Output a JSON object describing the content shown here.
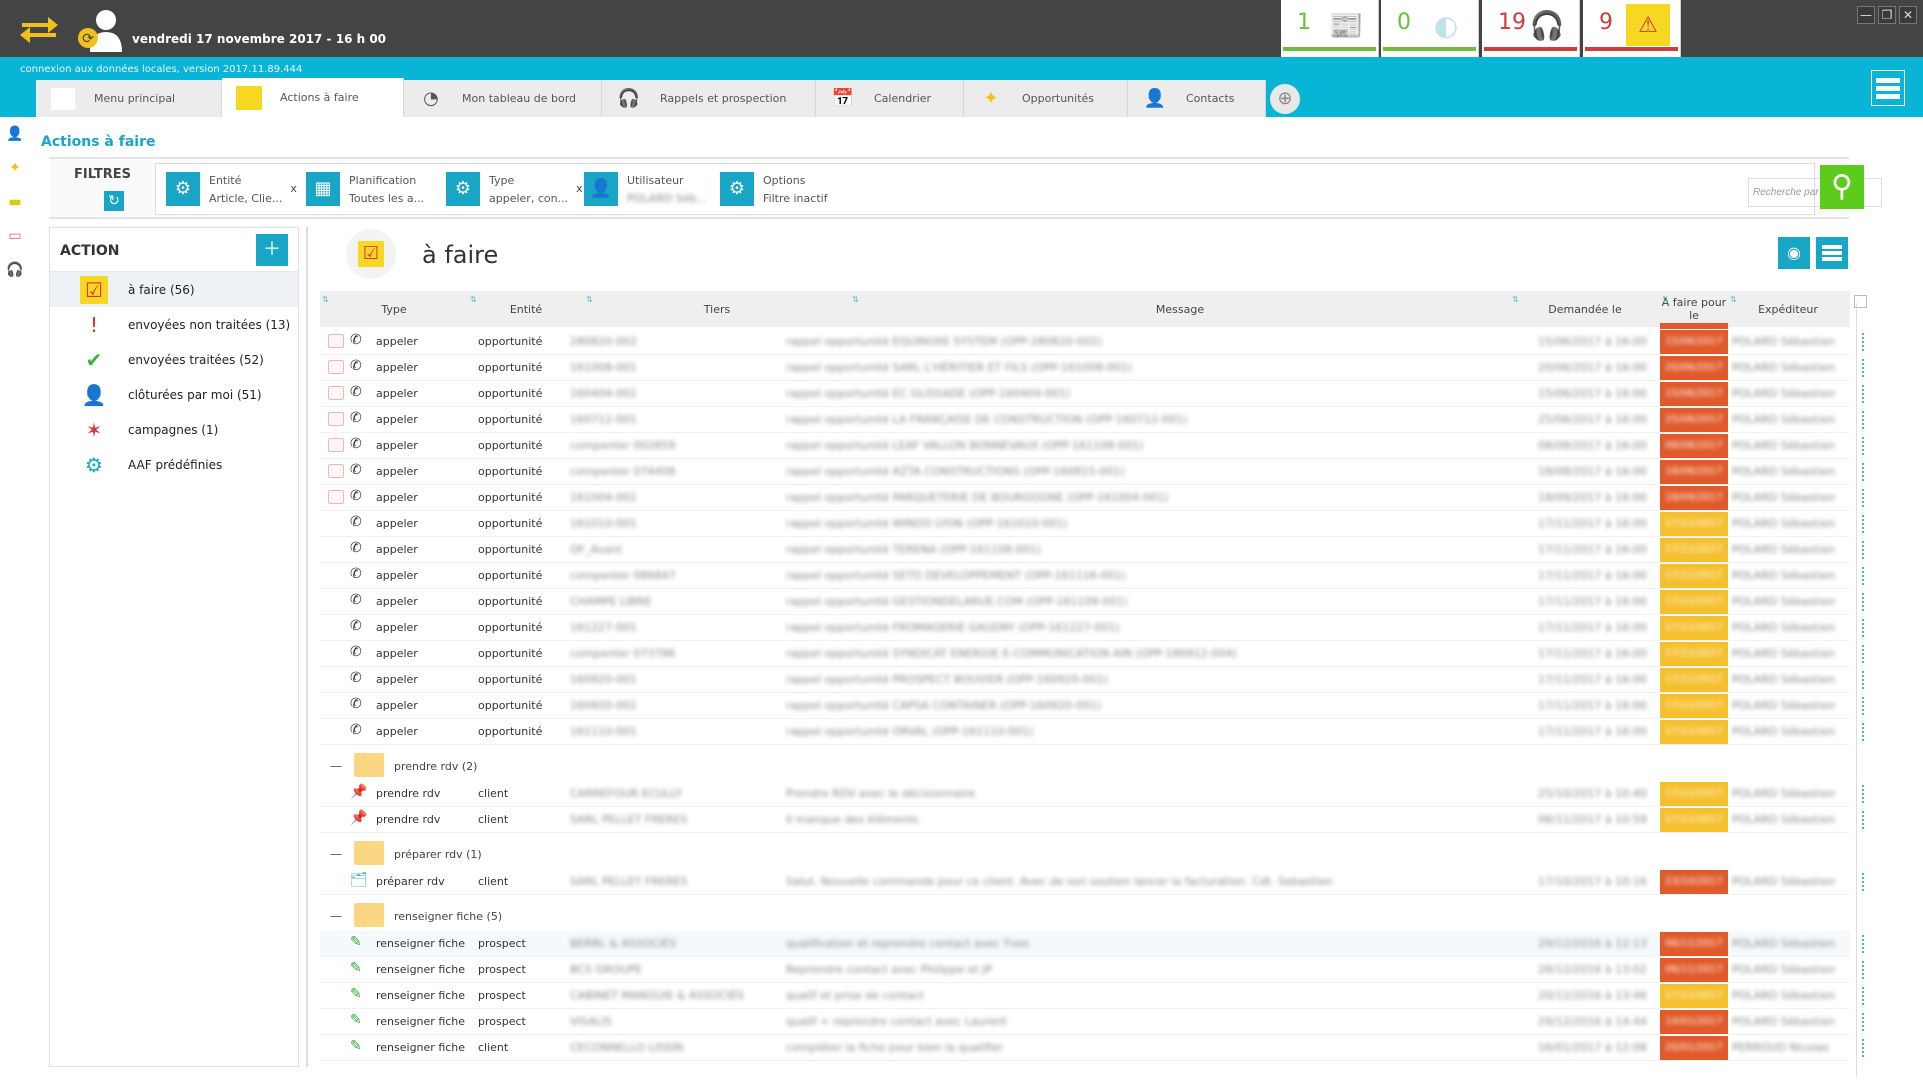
{
  "topbar": {
    "datetime": "vendredi 17 novembre 2017 - 16 h 00",
    "counters": [
      {
        "name": "news",
        "value": "1",
        "icon": "newspaper-icon",
        "color": "#6cbf3a"
      },
      {
        "name": "messages",
        "value": "0",
        "icon": "chat-bubble-icon",
        "color": "#6cbf3a"
      },
      {
        "name": "calls",
        "value": "19",
        "icon": "headset-icon",
        "color": "#c9403b"
      },
      {
        "name": "alerts",
        "value": "9",
        "icon": "warning-icon",
        "color": "#c9403b"
      }
    ],
    "window_buttons": [
      "—",
      "❐",
      "✕"
    ]
  },
  "connection_status": "connexion aux données locales, version 2017.11.89.444",
  "tabs": [
    {
      "label": "Menu principal",
      "icon": "home-icon"
    },
    {
      "label": "Actions à faire",
      "icon": "sticky-note-icon",
      "active": true
    },
    {
      "label": "Mon tableau de bord",
      "icon": "gauge-icon"
    },
    {
      "label": "Rappels et prospection",
      "icon": "headset-icon"
    },
    {
      "label": "Calendrier",
      "icon": "calendar-icon"
    },
    {
      "label": "Opportunités",
      "icon": "opportunity-icon"
    },
    {
      "label": "Contacts",
      "icon": "contacts-icon"
    }
  ],
  "breadcrumb": "Actions à faire",
  "filters": {
    "title": "FILTRES",
    "items": [
      {
        "label": "Entité",
        "value": "Article, Clie...",
        "removable": true
      },
      {
        "label": "Planification",
        "value": "Toutes les a...",
        "removable": false
      },
      {
        "label": "Type",
        "value": "appeler, con...",
        "removable": true
      },
      {
        "label": "Utilisateur",
        "value": "POLARD Séb...",
        "removable": false
      },
      {
        "label": "Options",
        "value": "Filtre inactif",
        "removable": false
      }
    ],
    "remove_label": "x",
    "search_placeholder": "Recherche par mot clé"
  },
  "action_panel": {
    "title": "ACTION",
    "items": [
      {
        "label": "à faire (56)",
        "icon": "todo-check-icon",
        "active": true
      },
      {
        "label": "envoyées non traitées (13)",
        "icon": "exclamation-icon"
      },
      {
        "label": "envoyées traitées (52)",
        "icon": "checkmark-icon"
      },
      {
        "label": "clôturées par moi (51)",
        "icon": "user-closed-icon"
      },
      {
        "label": "campagnes (1)",
        "icon": "campaign-icon"
      },
      {
        "label": "AAF prédéfinies",
        "icon": "gears-icon"
      }
    ]
  },
  "main": {
    "title": "à faire",
    "columns": [
      "Type",
      "Entité",
      "Tiers",
      "Message",
      "Demandée le",
      "A faire pour le",
      "Expéditeur"
    ],
    "due_colors": {
      "late": "#e05a2b",
      "today": "#f5c02e"
    },
    "call_rows": [
      {
        "type": "appeler",
        "entity": "opportunité",
        "tiers": "280820-002",
        "message": "rappel opportunité EQUINOXE SYSTEM (OPP-280820-002)",
        "requested": "15/06/2017 à 16:00",
        "due": "15/06/2017",
        "status": "late",
        "sender": "POLARD Sébastien",
        "flag": true
      },
      {
        "type": "appeler",
        "entity": "opportunité",
        "tiers": "161008-001",
        "message": "rappel opportunité SARL L'HÉRITIER ET FILS (OPP-161008-001)",
        "requested": "20/06/2017 à 16:00",
        "due": "20/06/2017",
        "status": "late",
        "sender": "POLARD Sébastien",
        "flag": true
      },
      {
        "type": "appeler",
        "entity": "opportunité",
        "tiers": "160404-001",
        "message": "rappel opportunité EC GLISSADE (OPP-160404-001)",
        "requested": "15/06/2017 à 16:00",
        "due": "15/06/2017",
        "status": "late",
        "sender": "POLARD Sébastien",
        "flag": true
      },
      {
        "type": "appeler",
        "entity": "opportunité",
        "tiers": "160712-001",
        "message": "rappel opportunité LA FRANÇAISE DE CONSTRUCTION (OPP-160712-001)",
        "requested": "25/06/2017 à 16:00",
        "due": "25/06/2017",
        "status": "late",
        "sender": "POLARD Sébastien",
        "flag": true
      },
      {
        "type": "appeler",
        "entity": "opportunité",
        "tiers": "compenter 002859",
        "message": "rappel opportunité LEAF VALLON BONNEVAUX (OPP-161108-001)",
        "requested": "08/08/2017 à 16:00",
        "due": "08/08/2017",
        "status": "late",
        "sender": "POLARD Sébastien",
        "flag": true
      },
      {
        "type": "appeler",
        "entity": "opportunité",
        "tiers": "compenter 074408",
        "message": "rappel opportunité AZTA CONSTRUCTIONS (OPP-160815-001)",
        "requested": "18/08/2017 à 16:00",
        "due": "18/08/2017",
        "status": "late",
        "sender": "POLARD Sébastien",
        "flag": true
      },
      {
        "type": "appeler",
        "entity": "opportunité",
        "tiers": "161004-001",
        "message": "rappel opportunité PARQUETERIE DE BOURGOGNE (OPP-161004-001)",
        "requested": "18/09/2017 à 16:00",
        "due": "18/09/2017",
        "status": "late",
        "sender": "POLARD Sébastien",
        "flag": true
      },
      {
        "type": "appeler",
        "entity": "opportunité",
        "tiers": "161010-001",
        "message": "rappel opportunité WINDO LYON (OPP-161010-001)",
        "requested": "17/11/2017 à 16:00",
        "due": "17/11/2017",
        "status": "today",
        "sender": "POLARD Sébastien",
        "flag": false
      },
      {
        "type": "appeler",
        "entity": "opportunité",
        "tiers": "OF_Avant",
        "message": "rappel opportunité TERENA (OPP-161108-001)",
        "requested": "17/11/2017 à 16:00",
        "due": "17/11/2017",
        "status": "today",
        "sender": "POLARD Sébastien",
        "flag": false
      },
      {
        "type": "appeler",
        "entity": "opportunité",
        "tiers": "compenter 086847",
        "message": "rappel opportunité SETO DEVELOPPEMENT (OPP-161116-001)",
        "requested": "17/11/2017 à 16:00",
        "due": "17/11/2017",
        "status": "today",
        "sender": "POLARD Sébastien",
        "flag": false
      },
      {
        "type": "appeler",
        "entity": "opportunité",
        "tiers": "CHAMPE LIBRE",
        "message": "rappel opportunité GESTIONDELARUE.COM (OPP-161109-001)",
        "requested": "17/11/2017 à 16:00",
        "due": "17/11/2017",
        "status": "today",
        "sender": "POLARD Sébastien",
        "flag": false
      },
      {
        "type": "appeler",
        "entity": "opportunité",
        "tiers": "161227-001",
        "message": "rappel opportunité FROMAGERIE GAUDRY (OPP-161227-001)",
        "requested": "17/11/2017 à 16:00",
        "due": "17/11/2017",
        "status": "today",
        "sender": "POLARD Sébastien",
        "flag": false
      },
      {
        "type": "appeler",
        "entity": "opportunité",
        "tiers": "compenter 073786",
        "message": "rappel opportunité SYNDICAT ENERGIE E-COMMUNICATION AIN (OPP-180912-004)",
        "requested": "17/11/2017 à 16:00",
        "due": "17/11/2017",
        "status": "today",
        "sender": "POLARD Sébastien",
        "flag": false
      },
      {
        "type": "appeler",
        "entity": "opportunité",
        "tiers": "160920-001",
        "message": "rappel opportunité PROSPECT BOUVIER (OPP-160920-001)",
        "requested": "17/11/2017 à 16:00",
        "due": "17/11/2017",
        "status": "today",
        "sender": "POLARD Sébastien",
        "flag": false
      },
      {
        "type": "appeler",
        "entity": "opportunité",
        "tiers": "160920-001",
        "message": "rappel opportunité CAPSA CONTAINER (OPP-160920-001)",
        "requested": "17/11/2017 à 16:00",
        "due": "17/11/2017",
        "status": "today",
        "sender": "POLARD Sébastien",
        "flag": false
      },
      {
        "type": "appeler",
        "entity": "opportunité",
        "tiers": "161110-001",
        "message": "rappel opportunité ORVAL (OPP-161110-001)",
        "requested": "17/11/2017 à 16:00",
        "due": "17/11/2017",
        "status": "today",
        "sender": "POLARD Sébastien",
        "flag": false
      }
    ],
    "groups": [
      {
        "label": "prendre rdv (2)",
        "rows": [
          {
            "type": "prendre rdv",
            "entity": "client",
            "tiers": "CARREFOUR ECULLY",
            "message": "Prendre RDV avec le décisionnaire",
            "requested": "25/10/2017 à 10:40",
            "due": "17/11/2017",
            "status": "today",
            "sender": "POLARD Sébastien"
          },
          {
            "type": "prendre rdv",
            "entity": "client",
            "tiers": "SARL PELLET FRERES",
            "message": "Il manque des éléments",
            "requested": "06/11/2017 à 10:59",
            "due": "17/11/2017",
            "status": "today",
            "sender": "POLARD Sébastien"
          }
        ]
      },
      {
        "label": "préparer rdv (1)",
        "rows": [
          {
            "type": "préparer rdv",
            "entity": "client",
            "tiers": "SARL PELLET FRERES",
            "message": "Salut. Nouvelle commande pour ce client. Avec de son soutien lancer la facturation. Cdt. Sebastien",
            "requested": "17/10/2017 à 10:16",
            "due": "23/10/2017",
            "status": "late",
            "sender": "POLARD Sébastien"
          }
        ]
      },
      {
        "label": "renseigner fiche (5)",
        "rows": [
          {
            "type": "renseigner fiche",
            "entity": "prospect",
            "tiers": "BERRL & ASSOCIÉS",
            "message": "qualification et reprendre contact avec Yves",
            "requested": "29/12/2016 à 12:13",
            "due": "06/11/2017",
            "status": "late",
            "sender": "POLARD Sébastien"
          },
          {
            "type": "renseigner fiche",
            "entity": "prospect",
            "tiers": "BCS GROUPE",
            "message": "Reprendre contact avec Philippe et JP",
            "requested": "28/12/2016 à 13:02",
            "due": "06/11/2017",
            "status": "late",
            "sender": "POLARD Sébastien"
          },
          {
            "type": "renseigner fiche",
            "entity": "prospect",
            "tiers": "CABINET MANGUIE & ASSOCIÉS",
            "message": "qualif et prise de contact",
            "requested": "20/12/2016 à 13:46",
            "due": "17/11/2017",
            "status": "today",
            "sender": "POLARD Sébastien"
          },
          {
            "type": "renseigner fiche",
            "entity": "prospect",
            "tiers": "VISALIS",
            "message": "qualif + reprendre contact avec Laurent",
            "requested": "29/12/2016 à 14:44",
            "due": "14/01/2017",
            "status": "late",
            "sender": "POLARD Sébastien"
          },
          {
            "type": "renseigner fiche",
            "entity": "client",
            "tiers": "CECONNELLO LISSIN",
            "message": "compléter la fiche pour bien la qualifier",
            "requested": "16/01/2017 à 12:08",
            "due": "20/01/2017",
            "status": "late",
            "sender": "PERROUD Nicolas"
          }
        ]
      }
    ]
  }
}
